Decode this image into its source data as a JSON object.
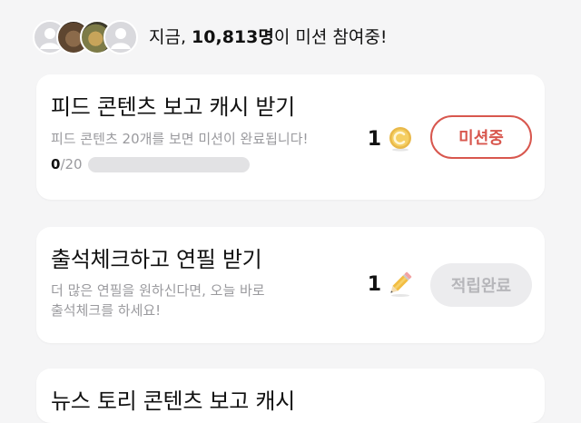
{
  "header": {
    "avatars": [
      "default-avatar-icon",
      "photo-avatar",
      "photo-avatar",
      "default-avatar-icon"
    ],
    "participation_prefix": "지금, ",
    "participation_count": "10,813명",
    "participation_suffix": "이 미션 참여중!"
  },
  "missions": [
    {
      "title": "피드 콘텐츠 보고 캐시 받기",
      "description": "피드 콘텐츠 20개를 보면 미션이 완료됩니다!",
      "progress_current": "0",
      "progress_total": "/20",
      "progress_fraction": 0,
      "reward_amount": "1",
      "reward_icon": "coin-icon",
      "button_label": "미션중",
      "button_state": "active",
      "accent_color": "#d8574e"
    },
    {
      "title": "출석체크하고 연필 받기",
      "description": "더 많은 연필을 원하신다면, 오늘 바로\n출석체크를 하세요!",
      "reward_amount": "1",
      "reward_icon": "pencil-icon",
      "button_label": "적립완료",
      "button_state": "done"
    },
    {
      "title": "뉴스 토리 콘텐츠 보고 캐시"
    }
  ]
}
